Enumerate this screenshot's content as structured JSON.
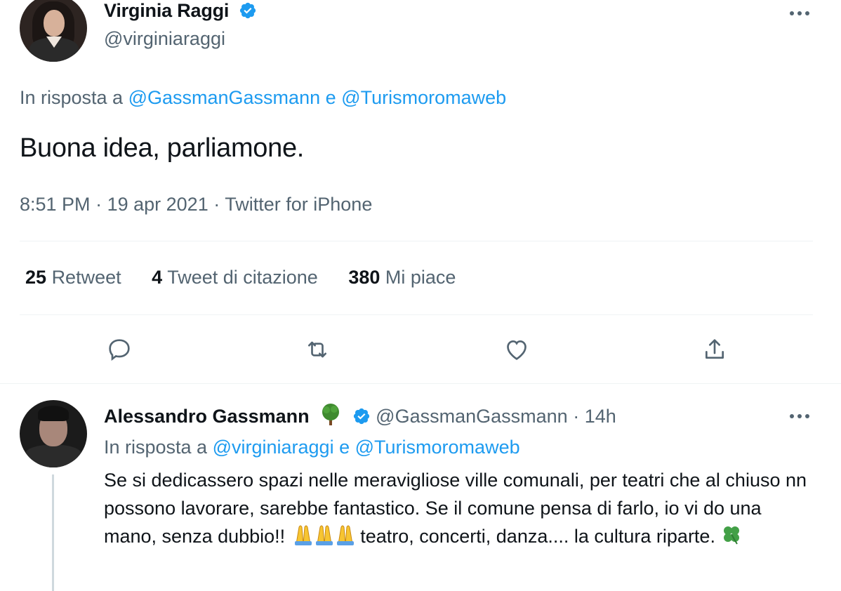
{
  "main_tweet": {
    "author_name": "Virginia Raggi",
    "handle": "@virginiaraggi",
    "reply_prefix": "In risposta a",
    "reply_user_1": "@GassmanGassmann",
    "reply_conj": "e",
    "reply_user_2": "@Turismoromaweb",
    "text": "Buona idea, parliamone.",
    "time": "8:51 PM",
    "date": "19 apr 2021",
    "source": "Twitter for iPhone",
    "sep": "·",
    "stats": {
      "retweets_count": "25",
      "retweets_label": "Retweet",
      "quotes_count": "4",
      "quotes_label": "Tweet di citazione",
      "likes_count": "380",
      "likes_label": "Mi piace"
    }
  },
  "reply_tweet": {
    "author_name": "Alessandro Gassmann",
    "handle": "@GassmanGassmann",
    "sep": "·",
    "time": "14h",
    "reply_prefix": "In risposta a",
    "reply_user_1": "@virginiaraggi",
    "reply_conj": "e",
    "reply_user_2": "@Turismoromaweb",
    "text_part1": "Se si dedicassero spazi nelle meravigliose ville comunali, per teatri che al chiuso nn possono lavorare, sarebbe fantastico. Se il comune pensa di farlo, io vi do una mano, senza dubbio!! ",
    "text_part2": " teatro, concerti, danza.... la cultura riparte. "
  },
  "colors": {
    "accent": "#1d9bf0",
    "muted": "#536471",
    "text": "#0f1419"
  },
  "icons": [
    "verified-badge-icon",
    "more-options-icon",
    "reply-icon",
    "retweet-icon",
    "like-icon",
    "share-icon",
    "tree-emoji-icon",
    "folded-hands-emoji-icon",
    "four-leaf-clover-emoji-icon"
  ]
}
